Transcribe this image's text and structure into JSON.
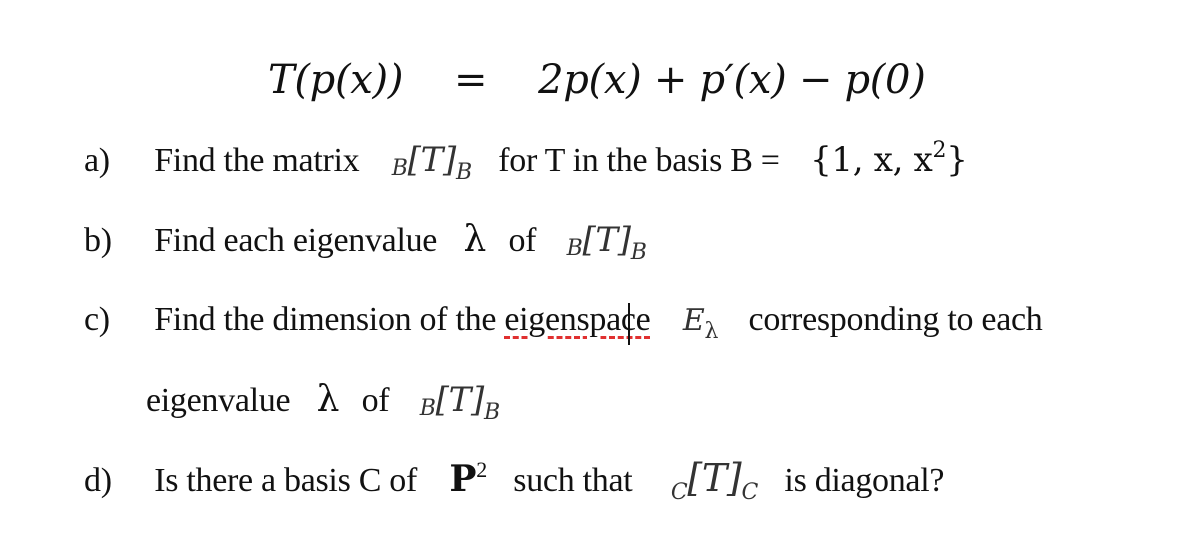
{
  "equation": {
    "lhs": "T(p(x))",
    "equals": "=",
    "rhs": "2p(x) + p′(x) − p(0)"
  },
  "questions": [
    {
      "label": "a)",
      "text_before": "Find the matrix",
      "matrix": {
        "pre": "B",
        "body": "[T]",
        "sub": "B"
      },
      "text_after": "for T in the basis B =",
      "basis_set": "{1, x,  x",
      "basis_sup": "2",
      "basis_close": "}"
    },
    {
      "label": "b)",
      "text_before": "Find each eigenvalue",
      "symbol": "λ",
      "text_of": "of",
      "matrix": {
        "pre": "B",
        "body": "[T]",
        "sub": "B"
      }
    },
    {
      "label": "c)",
      "text_before": "Find the dimension of the",
      "misspelled_word": "eigenspace",
      "eigenspace_symbol": "E",
      "eigenspace_sub": "λ",
      "text_after": "corresponding to each",
      "continuation": {
        "text_before": "eigenvalue",
        "symbol": "λ",
        "text_of": "of",
        "matrix": {
          "pre": "B",
          "body": "[T]",
          "sub": "B"
        }
      }
    },
    {
      "label": "d)",
      "text_before": "Is there a basis C of",
      "space": "P",
      "space_sup": "2",
      "text_mid": "such that",
      "matrix": {
        "pre": "C",
        "body": "[T]",
        "sub": "C"
      },
      "text_after": "is diagonal?"
    }
  ],
  "colors": {
    "text": "#111111",
    "spellcheck_underline": "#e03030"
  }
}
